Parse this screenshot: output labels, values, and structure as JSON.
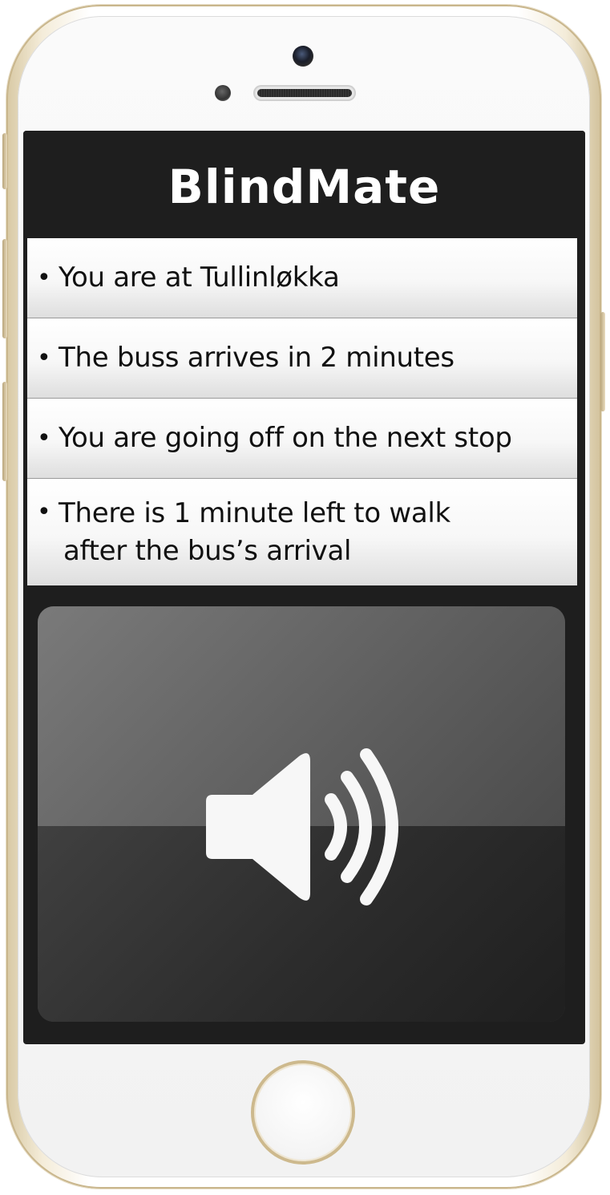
{
  "app": {
    "title": "BlindMate"
  },
  "info_items": [
    {
      "bullet": "•",
      "text": "You are at Tullinløkka"
    },
    {
      "bullet": "•",
      "text": "The buss arrives in 2 minutes"
    },
    {
      "bullet": "•",
      "text": "You are going off on the next stop"
    },
    {
      "bullet": "•",
      "text_line1": "There is 1 minute left to walk",
      "text_line2": "after the bus’s arrival"
    }
  ],
  "sound_button": {
    "icon": "speaker-volume-icon"
  },
  "device": {
    "home_button_icon": "home-button",
    "frame_color": "#d8c9a4",
    "screen_background": "#1e1e1e"
  }
}
